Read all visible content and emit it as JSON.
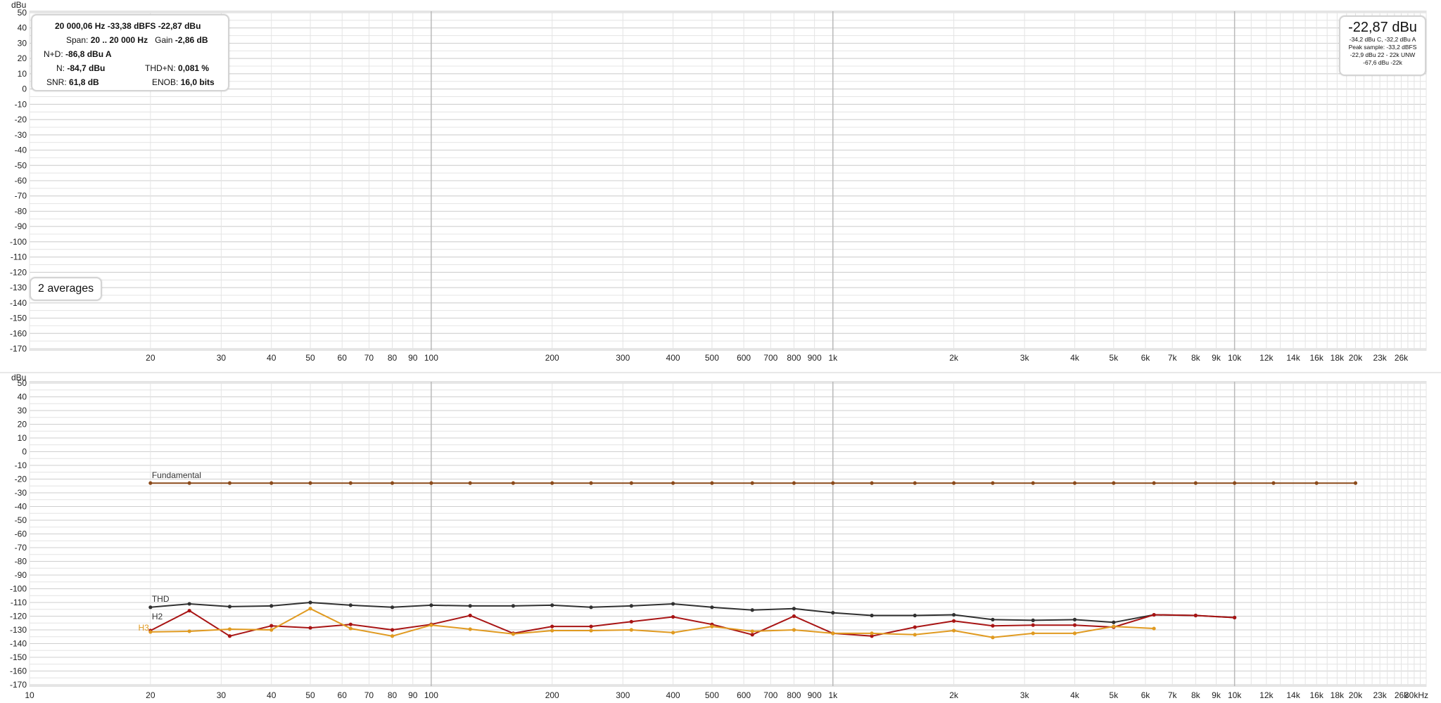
{
  "info": {
    "line1": "20 000,06 Hz  -33,38 dBFS  -22,87 dBu",
    "span_label": "Span:",
    "span_value": "20 .. 20 000 Hz",
    "gain_label": "Gain",
    "gain_value": "-2,86 dB",
    "nd_label": "N+D:",
    "nd_value": "-86,8 dBu A",
    "n_label": "N:",
    "n_value": "-84,7 dBu",
    "thdn_label": "THD+N:",
    "thdn_value": "0,081 %",
    "snr_label": "SNR:",
    "snr_value": "61,8 dB",
    "enob_label": "ENOB:",
    "enob_value": "16,0 bits"
  },
  "averages": "2 averages",
  "level": {
    "main": "-22,87 dBu",
    "line1": "-34,2 dBu C, -32,2 dBu A",
    "line2": "Peak sample: -33,2 dBFS",
    "line3": "-22,9 dBu 22 - 22k UNW",
    "line4": "-67,6 dBu -22k"
  },
  "colors": {
    "fundamental": "#8b4a1b",
    "thd": "#303030",
    "h2": "#a81414",
    "h3": "#e09a20",
    "grid_minor": "#e4e4e4",
    "grid_major": "#b9b9b9"
  },
  "chart_data": [
    {
      "type": "line",
      "panel": "top",
      "ylabel": "dBu",
      "ylim": [
        -170,
        50
      ],
      "y_ticks": [
        "50",
        "40",
        "30",
        "20",
        "10",
        "0",
        "-10",
        "-20",
        "-30",
        "-40",
        "-50",
        "-60",
        "-70",
        "-80",
        "-90",
        "-100",
        "-110",
        "-120",
        "-130",
        "-140",
        "-150",
        "-160",
        "-170"
      ],
      "x_scale": "log",
      "x_ticks": [
        {
          "v": 20,
          "t": "20"
        },
        {
          "v": 30,
          "t": "30"
        },
        {
          "v": 40,
          "t": "40"
        },
        {
          "v": 50,
          "t": "50"
        },
        {
          "v": 60,
          "t": "60"
        },
        {
          "v": 70,
          "t": "70"
        },
        {
          "v": 80,
          "t": "80"
        },
        {
          "v": 90,
          "t": "90"
        },
        {
          "v": 100,
          "t": "100"
        },
        {
          "v": 200,
          "t": "200"
        },
        {
          "v": 300,
          "t": "300"
        },
        {
          "v": 400,
          "t": "400"
        },
        {
          "v": 500,
          "t": "500"
        },
        {
          "v": 600,
          "t": "600"
        },
        {
          "v": 700,
          "t": "700"
        },
        {
          "v": 800,
          "t": "800"
        },
        {
          "v": 900,
          "t": "900"
        },
        {
          "v": 1000,
          "t": "1k"
        },
        {
          "v": 2000,
          "t": "2k"
        },
        {
          "v": 3000,
          "t": "3k"
        },
        {
          "v": 4000,
          "t": "4k"
        },
        {
          "v": 5000,
          "t": "5k"
        },
        {
          "v": 6000,
          "t": "6k"
        },
        {
          "v": 7000,
          "t": "7k"
        },
        {
          "v": 8000,
          "t": "8k"
        },
        {
          "v": 9000,
          "t": "9k"
        },
        {
          "v": 10000,
          "t": "10k"
        },
        {
          "v": 12000,
          "t": "12k"
        },
        {
          "v": 14000,
          "t": "14k"
        },
        {
          "v": 16000,
          "t": "16k"
        },
        {
          "v": 18000,
          "t": "18k"
        },
        {
          "v": 20000,
          "t": "20k"
        },
        {
          "v": 23000,
          "t": "23k"
        },
        {
          "v": 26000,
          "t": "26k"
        }
      ],
      "series": []
    },
    {
      "type": "line",
      "panel": "bottom",
      "ylabel": "dBu",
      "ylim": [
        -170,
        50
      ],
      "y_ticks": [
        "50",
        "40",
        "30",
        "20",
        "10",
        "0",
        "-10",
        "-20",
        "-30",
        "-40",
        "-50",
        "-60",
        "-70",
        "-80",
        "-90",
        "-100",
        "-110",
        "-120",
        "-130",
        "-140",
        "-150",
        "-160",
        "-170"
      ],
      "x_scale": "log",
      "xlim": [
        10,
        30000
      ],
      "x_ticks": [
        {
          "v": 10,
          "t": "10"
        },
        {
          "v": 20,
          "t": "20"
        },
        {
          "v": 30,
          "t": "30"
        },
        {
          "v": 40,
          "t": "40"
        },
        {
          "v": 50,
          "t": "50"
        },
        {
          "v": 60,
          "t": "60"
        },
        {
          "v": 70,
          "t": "70"
        },
        {
          "v": 80,
          "t": "80"
        },
        {
          "v": 90,
          "t": "90"
        },
        {
          "v": 100,
          "t": "100"
        },
        {
          "v": 200,
          "t": "200"
        },
        {
          "v": 300,
          "t": "300"
        },
        {
          "v": 400,
          "t": "400"
        },
        {
          "v": 500,
          "t": "500"
        },
        {
          "v": 600,
          "t": "600"
        },
        {
          "v": 700,
          "t": "700"
        },
        {
          "v": 800,
          "t": "800"
        },
        {
          "v": 900,
          "t": "900"
        },
        {
          "v": 1000,
          "t": "1k"
        },
        {
          "v": 2000,
          "t": "2k"
        },
        {
          "v": 3000,
          "t": "3k"
        },
        {
          "v": 4000,
          "t": "4k"
        },
        {
          "v": 5000,
          "t": "5k"
        },
        {
          "v": 6000,
          "t": "6k"
        },
        {
          "v": 7000,
          "t": "7k"
        },
        {
          "v": 8000,
          "t": "8k"
        },
        {
          "v": 9000,
          "t": "9k"
        },
        {
          "v": 10000,
          "t": "10k"
        },
        {
          "v": 12000,
          "t": "12k"
        },
        {
          "v": 14000,
          "t": "14k"
        },
        {
          "v": 16000,
          "t": "16k"
        },
        {
          "v": 18000,
          "t": "18k"
        },
        {
          "v": 20000,
          "t": "20k"
        },
        {
          "v": 23000,
          "t": "23k"
        },
        {
          "v": 26000,
          "t": "26k"
        },
        {
          "v": 30000,
          "t": "30kHz"
        }
      ],
      "series": [
        {
          "name": "Fundamental",
          "color": "#8b4a1b",
          "x": [
            20,
            25,
            31.5,
            40,
            50,
            63,
            80,
            100,
            125,
            160,
            200,
            250,
            315,
            400,
            500,
            630,
            800,
            1000,
            1250,
            1600,
            2000,
            2500,
            3150,
            4000,
            5000,
            6300,
            8000,
            10000,
            12500,
            16000,
            20000
          ],
          "y": [
            -22.9,
            -22.9,
            -22.9,
            -22.9,
            -22.9,
            -22.9,
            -22.9,
            -22.9,
            -22.9,
            -22.9,
            -22.9,
            -22.9,
            -22.9,
            -22.9,
            -22.9,
            -22.9,
            -22.9,
            -22.9,
            -22.9,
            -22.9,
            -22.9,
            -22.9,
            -22.9,
            -22.9,
            -22.9,
            -22.9,
            -22.9,
            -22.9,
            -22.9,
            -22.9,
            -22.9
          ]
        },
        {
          "name": "THD",
          "color": "#303030",
          "x": [
            20,
            25,
            31.5,
            40,
            50,
            63,
            80,
            100,
            125,
            160,
            200,
            250,
            315,
            400,
            500,
            630,
            800,
            1000,
            1250,
            1600,
            2000,
            2500,
            3150,
            4000,
            5000,
            6300,
            8000,
            10000
          ],
          "y": [
            -113.5,
            -111,
            -113,
            -112.5,
            -110,
            -112,
            -113.5,
            -112,
            -112.5,
            -112.5,
            -112,
            -113.5,
            -112.5,
            -111,
            -113.5,
            -115.5,
            -114.5,
            -117.5,
            -119.5,
            -119.5,
            -119,
            -122.5,
            -123,
            -122.5,
            -124.5,
            -119,
            -119.5,
            -121
          ]
        },
        {
          "name": "H2",
          "color": "#a81414",
          "x": [
            20,
            25,
            31.5,
            40,
            50,
            63,
            80,
            100,
            125,
            160,
            200,
            250,
            315,
            400,
            500,
            630,
            800,
            1000,
            1250,
            1600,
            2000,
            2500,
            3150,
            4000,
            5000,
            6300,
            8000,
            10000
          ],
          "y": [
            -130.5,
            -116,
            -134.5,
            -127,
            -128.5,
            -126,
            -130,
            -126,
            -119.5,
            -132.5,
            -127.5,
            -127.5,
            -124,
            -120.5,
            -126,
            -133.5,
            -120,
            -132.5,
            -134.5,
            -128,
            -123.5,
            -127,
            -126.5,
            -126.5,
            -128,
            -119,
            -119.5,
            -121
          ]
        },
        {
          "name": "H3",
          "color": "#e09a20",
          "x": [
            20,
            25,
            31.5,
            40,
            50,
            63,
            80,
            100,
            125,
            160,
            200,
            250,
            315,
            400,
            500,
            630,
            800,
            1000,
            1250,
            1600,
            2000,
            2500,
            3150,
            4000,
            5000,
            6300
          ],
          "y": [
            -131.5,
            -131,
            -129.5,
            -130,
            -114.5,
            -129,
            -134.5,
            -126.5,
            -129.5,
            -133,
            -130.5,
            -130.5,
            -130,
            -132,
            -127.5,
            -131,
            -130,
            -132.5,
            -132.5,
            -133.5,
            -130.5,
            -135.5,
            -132.5,
            -132.5,
            -127.5,
            -129
          ]
        }
      ]
    }
  ]
}
